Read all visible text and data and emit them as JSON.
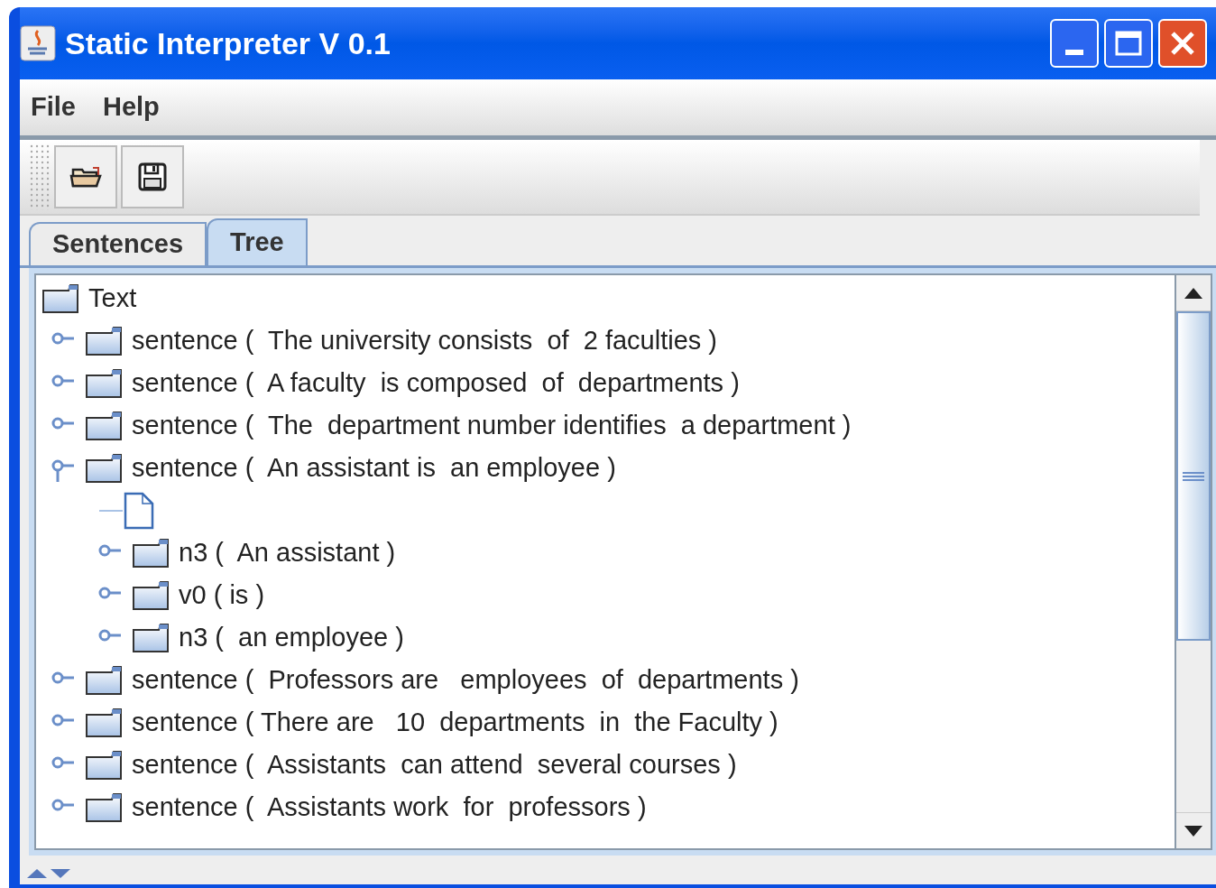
{
  "window": {
    "title": "Static Interpreter V 0.1"
  },
  "menu": [
    "File",
    "Help"
  ],
  "tabs": [
    {
      "label": "Sentences",
      "selected": false
    },
    {
      "label": "Tree",
      "selected": true
    }
  ],
  "tree": {
    "label": "Text",
    "children": [
      {
        "kind": "node",
        "label": "sentence (  The university consists  of  2 faculties )",
        "expanded": false
      },
      {
        "kind": "node",
        "label": "sentence (  A faculty  is composed  of  departments )",
        "expanded": false
      },
      {
        "kind": "node",
        "label": "sentence (  The  department number identifies  a department )",
        "expanded": false
      },
      {
        "kind": "node",
        "label": "sentence (  An assistant is  an employee )",
        "expanded": true,
        "children": [
          {
            "kind": "leaf"
          },
          {
            "kind": "node",
            "label": "n3 (  An assistant )",
            "expanded": false
          },
          {
            "kind": "node",
            "label": "v0 ( is )",
            "expanded": false
          },
          {
            "kind": "node",
            "label": "n3 (  an employee )",
            "expanded": false
          }
        ]
      },
      {
        "kind": "node",
        "label": "sentence (  Professors are   employees  of  departments )",
        "expanded": false
      },
      {
        "kind": "node",
        "label": "sentence ( There are   10  departments  in  the Faculty )",
        "expanded": false
      },
      {
        "kind": "node",
        "label": "sentence (  Assistants  can attend  several courses )",
        "expanded": false
      },
      {
        "kind": "node",
        "label": "sentence (  Assistants work  for  professors )",
        "expanded": false
      }
    ]
  }
}
